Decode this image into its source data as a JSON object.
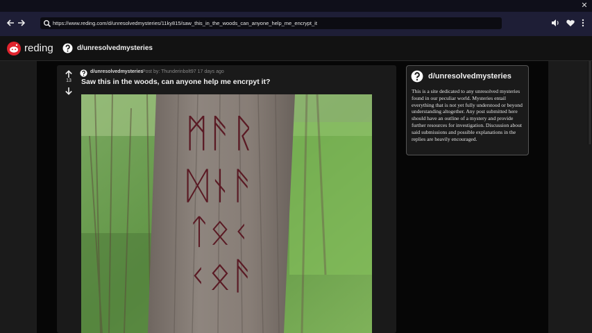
{
  "browser": {
    "url": "https://www.reding.com/d/unresolvedmysteries/11ky815/saw_this_in_the_woods_can_anyone_help_me_encrypt_it",
    "back_icon": "arrow-left-icon",
    "forward_icon": "arrow-right-icon",
    "close_icon": "close-icon"
  },
  "site": {
    "logo_text": "reding",
    "brand_color": "#e0242e",
    "subreddit": "d/unresolvedmysteries"
  },
  "post": {
    "votes": "13",
    "subreddit": "d/unresolvedmysteries",
    "meta": "Post by: Thunderinbolt97   17 days ago",
    "title": "Saw this in the woods, can anyone help me encrpyt it?",
    "image_runes": [
      "ᛗᚫᚱ",
      "ᛞᚾᚫ",
      "ᛏᛟᚲ",
      "ᚲᛟᚫ"
    ]
  },
  "sidebar": {
    "title": "d/unresolvedmysteries",
    "description": "This is a site dedicated to any unresolved mysteries found in our peculiar world. Mysteries entail everything that is not yet fully understood or beyond understanding altogether. Any post submitted here should have an outline of a mystery and provide further resources for investigation. Discussion about said submissions and possible explanations in the replies are heavily encouraged."
  }
}
